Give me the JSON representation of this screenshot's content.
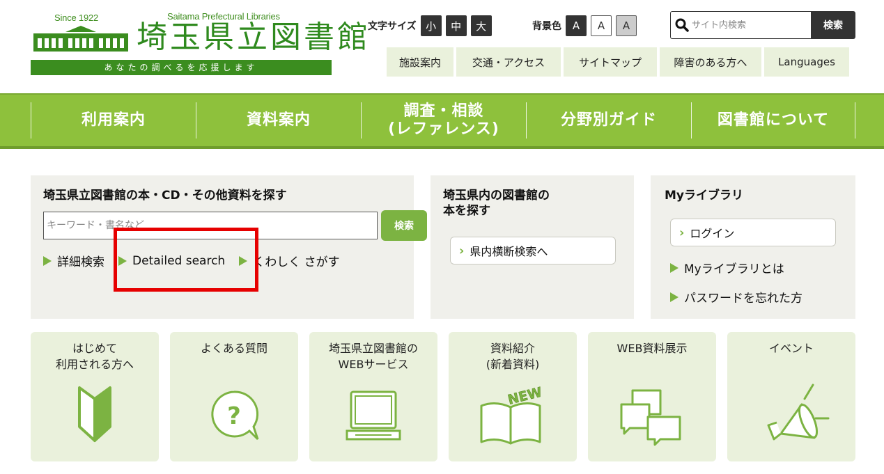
{
  "header": {
    "since": "Since 1922",
    "name_en": "Saitama Prefectural Libraries",
    "name_jp": "埼玉県立図書館",
    "tagline": "あなたの調べるを応援します",
    "font_size_label": "文字サイズ",
    "font_sizes": [
      "小",
      "中",
      "大"
    ],
    "bg_color_label": "背景色",
    "bg_colors": [
      "A",
      "A",
      "A"
    ],
    "search_placeholder": "サイト内検索",
    "search_button": "検索",
    "util_nav": [
      "施設案内",
      "交通・アクセス",
      "サイトマップ",
      "障害のある方へ",
      "Languages"
    ]
  },
  "main_nav": [
    {
      "label": "利用案内"
    },
    {
      "label": "資料案内"
    },
    {
      "label": "調査・相談\n(レファレンス)"
    },
    {
      "label": "分野別ガイド"
    },
    {
      "label": "図書館について"
    }
  ],
  "catalog": {
    "title": "埼玉県立図書館の本・CD・その他資料を探す",
    "placeholder": "キーワード・書名など",
    "search_button": "検索",
    "links": [
      "詳細検索",
      "Detailed search",
      "くわしく さがす"
    ]
  },
  "prefecture": {
    "title": "埼玉県内の図書館の\n本を探す",
    "link": "県内横断検索へ"
  },
  "mylibrary": {
    "title": "Myライブラリ",
    "login": "ログイン",
    "about": "Myライブラリとは",
    "forgot": "パスワードを忘れた方"
  },
  "tiles": [
    {
      "title": "はじめて\n利用される方へ",
      "icon": "beginner-mark-icon"
    },
    {
      "title": "よくある質問",
      "icon": "question-bubble-icon"
    },
    {
      "title": "埼玉県立図書館の\nWEBサービス",
      "icon": "laptop-icon"
    },
    {
      "title": "資料紹介\n(新着資料)",
      "icon": "new-book-icon",
      "badge": "NEW"
    },
    {
      "title": "WEB資料展示",
      "icon": "documents-icon"
    },
    {
      "title": "イベント",
      "icon": "megaphone-icon"
    }
  ],
  "colors": {
    "brand_green": "#3b8d1f",
    "nav_green": "#8ec13c",
    "light_green": "#eaf1dc",
    "accent_green": "#7cb342",
    "panel_gray": "#f0f0eb",
    "highlight_red": "#e60000"
  }
}
